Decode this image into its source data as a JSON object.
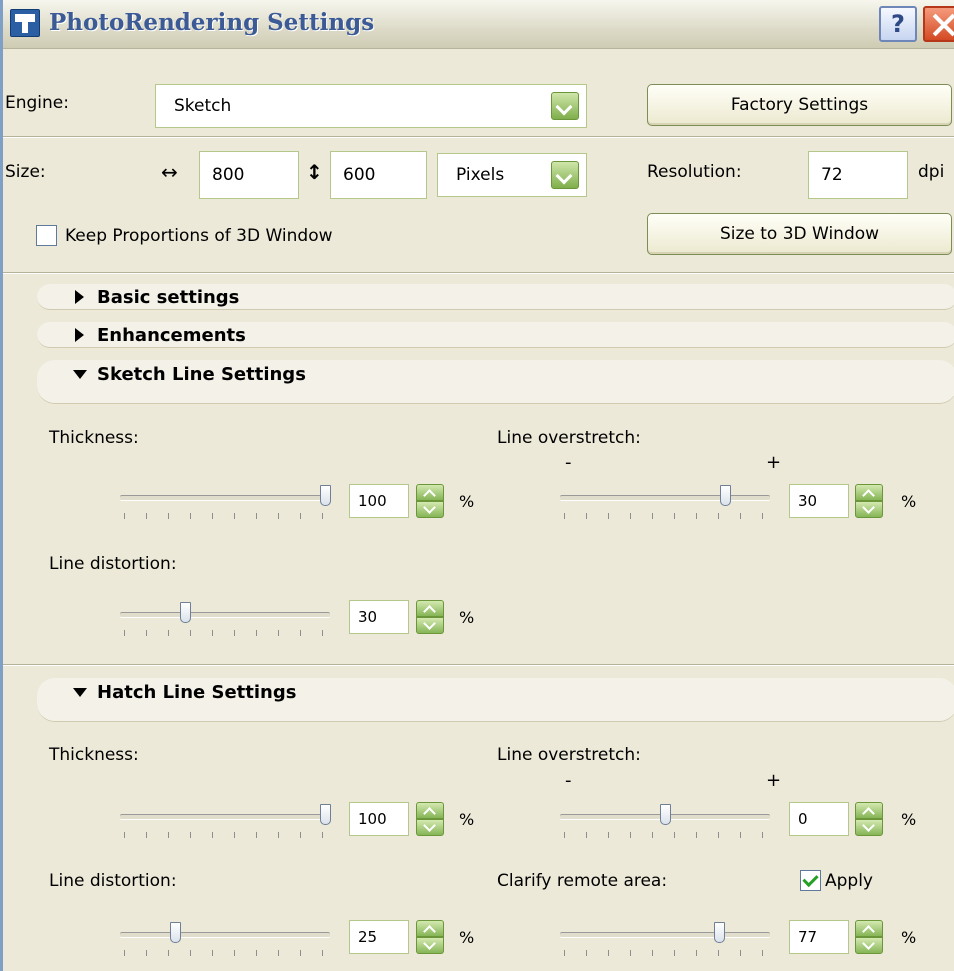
{
  "window": {
    "title": "PhotoRendering Settings",
    "help_label": "?"
  },
  "engine": {
    "label": "Engine:",
    "value": "Sketch",
    "factory_button": "Factory Settings"
  },
  "size": {
    "label": "Size:",
    "width_icon": "horizontal-double-arrow-icon",
    "width": "800",
    "height_icon": "vertical-double-arrow-icon",
    "height": "600",
    "unit": "Pixels",
    "resolution_label": "Resolution:",
    "resolution": "72",
    "resolution_unit": "dpi"
  },
  "keep_proportions": {
    "label": "Keep Proportions of 3D Window",
    "checked": false
  },
  "size_to_window_button": "Size to 3D Window",
  "sections": {
    "basic": {
      "title": "Basic settings",
      "expanded": false
    },
    "enhancements": {
      "title": "Enhancements",
      "expanded": false
    }
  },
  "sketch": {
    "title": "Sketch Line Settings",
    "thickness_label": "Thickness:",
    "thickness": {
      "value": "100",
      "unit": "%",
      "level": 1.0
    },
    "overstretch_label": "Line overstretch:",
    "overstretch_minus": "-",
    "overstretch_plus": "+",
    "overstretch": {
      "value": "30",
      "unit": "%",
      "level": 0.8
    },
    "distortion_label": "Line distortion:",
    "distortion": {
      "value": "30",
      "unit": "%",
      "level": 0.3
    }
  },
  "hatch": {
    "title": "Hatch Line Settings",
    "thickness_label": "Thickness:",
    "thickness": {
      "value": "100",
      "unit": "%",
      "level": 1.0
    },
    "overstretch_label": "Line overstretch:",
    "overstretch_minus": "-",
    "overstretch_plus": "+",
    "overstretch": {
      "value": "0",
      "unit": "%",
      "level": 0.5
    },
    "distortion_label": "Line distortion:",
    "distortion": {
      "value": "25",
      "unit": "%",
      "level": 0.25
    },
    "clarify_label": "Clarify remote area:",
    "apply_label": "Apply",
    "apply_checked": true,
    "clarify": {
      "value": "77",
      "unit": "%",
      "level": 0.77
    }
  }
}
